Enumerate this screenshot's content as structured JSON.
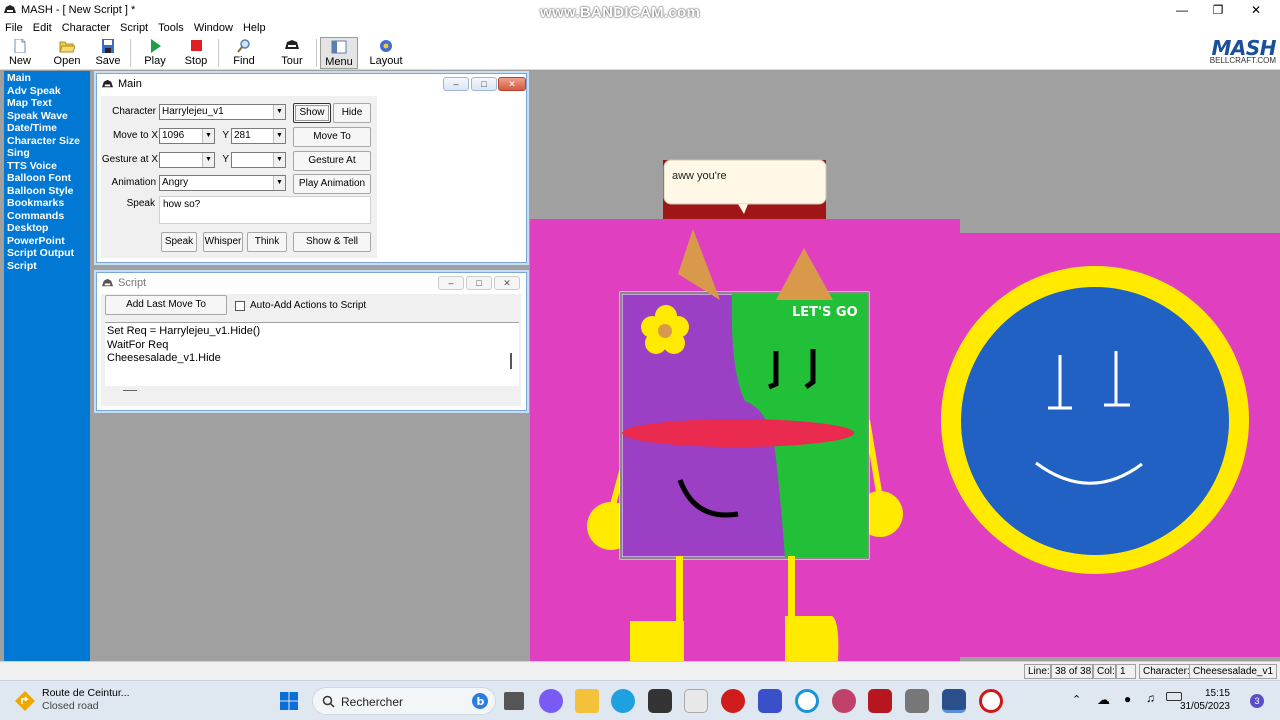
{
  "window": {
    "title": "MASH - [ New Script ] *",
    "watermark": "www.BANDICAM.com"
  },
  "menubar": [
    "File",
    "Edit",
    "Character",
    "Script",
    "Tools",
    "Window",
    "Help"
  ],
  "toolbar": {
    "new": "New",
    "open": "Open",
    "save": "Save",
    "play": "Play",
    "stop": "Stop",
    "find": "Find",
    "tour": "Tour",
    "menu": "Menu",
    "layout": "Layout"
  },
  "brand": {
    "logo": "MASH",
    "sub": "BELLCRAFT.COM"
  },
  "sidebar": [
    "Main",
    "Adv Speak",
    "Map Text",
    "Speak Wave",
    "Date/Time",
    "Character Size",
    "Sing",
    "TTS Voice",
    "Balloon Font",
    "Balloon Style",
    "Bookmarks",
    "Commands",
    "Desktop",
    "PowerPoint",
    "Script Output",
    "Script"
  ],
  "main_window": {
    "title": "Main",
    "character_label": "Character",
    "character_value": "Harrylejeu_v1",
    "show": "Show",
    "hide": "Hide",
    "moveto_label": "Move to X",
    "moveto_x": "1096",
    "y_label": "Y",
    "moveto_y": "281",
    "move_to": "Move To",
    "gesture_label": "Gesture at X",
    "gesture_x": "",
    "gesture_y": "",
    "gesture_at": "Gesture At",
    "animation_label": "Animation",
    "animation_value": "Angry",
    "play_animation": "Play Animation",
    "speak_label": "Speak",
    "speak_value": "how so?",
    "speak": "Speak",
    "whisper": "Whisper",
    "think": "Think",
    "show_tell": "Show & Tell"
  },
  "script_window": {
    "title": "Script",
    "add_last_move": "Add Last Move To",
    "auto_add": "Auto-Add Actions to Script",
    "lines": [
      "Set Req = Harrylejeu_v1.Hide()",
      "WaitFor Req",
      "Cheesesalade_v1.Hide"
    ]
  },
  "stage": {
    "balloon_text": "aww you're",
    "sign_text": "LET'S GO",
    "colors": {
      "magenta": "#e040c0",
      "purple": "#9b3fc4",
      "green": "#22c038",
      "yellow": "#ffea00",
      "blue": "#2161c4",
      "orange": "#d89a4a"
    }
  },
  "statusbar": {
    "line_label": "Line:",
    "line_value": "38 of 38",
    "col_label": "Col:",
    "col_value": "1",
    "character_label": "Character:",
    "character_value": "Cheesesalade_v1"
  },
  "taskbar": {
    "notif_title": "Route de Ceintur...",
    "notif_sub": "Closed road",
    "search_placeholder": "Rechercher",
    "time": "15:15",
    "date": "31/05/2023",
    "badge": "3"
  }
}
